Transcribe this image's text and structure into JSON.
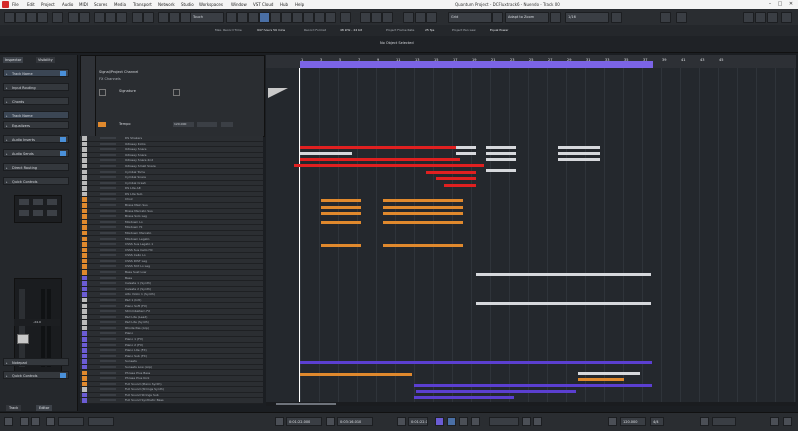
{
  "window": {
    "title": "Quantum Project - DCFluxtrack6 - Nuendo - Track 00"
  },
  "menu": [
    "File",
    "Edit",
    "Project",
    "Audio",
    "MIDI",
    "Scores",
    "Media",
    "Transport",
    "Network",
    "Studio",
    "Workspaces",
    "Window",
    "VST Cloud",
    "Hub",
    "Help"
  ],
  "toolbar": {
    "touch_mode": "Touch",
    "snap_mode": "Grid",
    "snap_type": "Adapt to Zoom",
    "quantize": "1/16"
  },
  "infoline": {
    "cells": [
      "Max. Record Time",
      "947 hours 59 mins",
      "Record Format",
      "48 kHz - 24 bit",
      "Project Frame Rate",
      "25 fps",
      "Project Pan Law",
      "Equal Power"
    ]
  },
  "status": {
    "message": "No Object Selected"
  },
  "inspector": {
    "tabs": [
      "Inspector",
      "Visibility"
    ],
    "sections": [
      "Track Name",
      "Input Routing",
      "Chords",
      "Track Name",
      "Equalizers",
      "Audio Inserts",
      "Audio Sends",
      "Direct Routing",
      "Quick Controls",
      "Notepad",
      "Quick Controls"
    ],
    "bottom_tabs": [
      "Track",
      "Editor"
    ],
    "fader_value": "-24.0"
  },
  "trackhead": {
    "project_label": "Signal/Project Channel",
    "sub_label": "FX Channels",
    "signature_label": "Signature",
    "tempo_label": "Tempo",
    "tempo_value": "120.000"
  },
  "tracks": [
    {
      "name": "DS Shakers",
      "color": "#bbbbbb"
    },
    {
      "name": "Odissey Kicks",
      "color": "#bbbbbb"
    },
    {
      "name": "Odissey Snare",
      "color": "#bbbbbb"
    },
    {
      "name": "Odissey Snare",
      "color": "#bbbbbb"
    },
    {
      "name": "Odissey Snare 2nd",
      "color": "#bbbbbb"
    },
    {
      "name": "Odissey Small Snare",
      "color": "#bbbbbb"
    },
    {
      "name": "Cymbal Toms",
      "color": "#bbbbbb"
    },
    {
      "name": "Cymbal Snare",
      "color": "#bbbbbb"
    },
    {
      "name": "Cymbal Crash",
      "color": "#bbbbbb"
    },
    {
      "name": "DS Lite Alt",
      "color": "#bbbbbb"
    },
    {
      "name": "DS Lite Sub",
      "color": "#bbbbbb"
    },
    {
      "name": "Choir",
      "color": "#e0892d"
    },
    {
      "name": "Brass Main Sus",
      "color": "#e0892d"
    },
    {
      "name": "Brass Marcato Sus",
      "color": "#e0892d"
    },
    {
      "name": "Brass Solo Leg",
      "color": "#e0892d"
    },
    {
      "name": "Mixdown Lo",
      "color": "#e0892d"
    },
    {
      "name": "Mixdown Hi",
      "color": "#e0892d"
    },
    {
      "name": "Mixdown Marcato",
      "color": "#e0892d"
    },
    {
      "name": "Mixdown Legato",
      "color": "#e0892d"
    },
    {
      "name": "CSSS Sus Legato 1",
      "color": "#e0892d"
    },
    {
      "name": "CSSS Sus Cello Hil",
      "color": "#e0892d"
    },
    {
      "name": "CSSS Cello Lo",
      "color": "#e0892d"
    },
    {
      "name": "CSSS DIST Leg",
      "color": "#e0892d"
    },
    {
      "name": "CSSS Strt Lo Leg",
      "color": "#e0892d"
    },
    {
      "name": "Bass Sust Low",
      "color": "#e0892d"
    },
    {
      "name": "Bass",
      "color": "#6b5cd4"
    },
    {
      "name": "Celeste 1 (Synth)",
      "color": "#6b5cd4"
    },
    {
      "name": "Celeste 2 (Synth)",
      "color": "#6b5cd4"
    },
    {
      "name": "Alto Violin 1 (Synth)",
      "color": "#6b5cd4"
    },
    {
      "name": "Pad 1 (Intl)",
      "color": "#bbbbbb"
    },
    {
      "name": "Piano Soft (FX)",
      "color": "#bbbbbb"
    },
    {
      "name": "Stimmbaltern FX",
      "color": "#bbbbbb"
    },
    {
      "name": "Pad Lite (Lead)",
      "color": "#bbbbbb"
    },
    {
      "name": "Pad Lite (Synth)",
      "color": "#bbbbbb"
    },
    {
      "name": "Rhode Pas (Arp)",
      "color": "#bbbbbb"
    },
    {
      "name": "Piano",
      "color": "#6b5cd4"
    },
    {
      "name": "Piano 1 (FX)",
      "color": "#6b5cd4"
    },
    {
      "name": "Piano 2 (FX)",
      "color": "#6b5cd4"
    },
    {
      "name": "Piano Lite (FX)",
      "color": "#6b5cd4"
    },
    {
      "name": "Piano Sub (FX)",
      "color": "#6b5cd4"
    },
    {
      "name": "Sunsets",
      "color": "#6b5cd4"
    },
    {
      "name": "Sunsets Low (Arp)",
      "color": "#6b5cd4"
    },
    {
      "name": "Phrase Plus Bass",
      "color": "#e0892d"
    },
    {
      "name": "Phrase Plus Kick",
      "color": "#e0892d"
    },
    {
      "name": "Full Sound (Piano Synth)",
      "color": "#e0892d"
    },
    {
      "name": "Full Sound (Strings Synth)",
      "color": "#bbbbbb"
    },
    {
      "name": "Full Sound Strings Sub",
      "color": "#6b5cd4"
    },
    {
      "name": "Full Sound Synthetic Bass",
      "color": "#6b5cd4"
    }
  ],
  "ruler": {
    "bars": [
      "1",
      "3",
      "5",
      "7",
      "9",
      "11",
      "13",
      "15",
      "17",
      "19",
      "21",
      "23",
      "25",
      "27",
      "29",
      "31",
      "33",
      "35",
      "37",
      "39",
      "41",
      "43",
      "45"
    ]
  },
  "events_colors": {
    "red": "#e02020",
    "white": "#d6d8dc",
    "orange": "#e0892d",
    "purple": "#5b3fd0",
    "purple_light": "#7b64e6"
  },
  "transport": {
    "left_locator": "0:01:22.000",
    "right_locator": "0:03:16.010",
    "position": "0:01:22.000",
    "tempo": "120.000",
    "signature": "4/4"
  }
}
